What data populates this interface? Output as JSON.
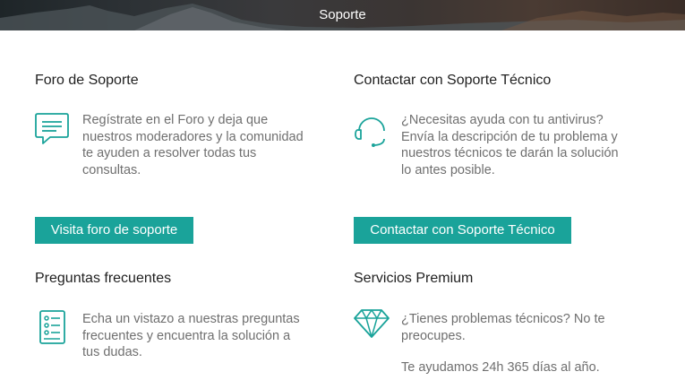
{
  "header": {
    "title": "Soporte"
  },
  "forum": {
    "title": "Foro de Soporte",
    "icon": "chat-bubble-icon",
    "desc": [
      "Regístrate en el Foro y deja que",
      "nuestros moderadores y la comunidad",
      "te ayuden a resolver todas tus",
      "consultas."
    ],
    "button": "Visita foro de soporte"
  },
  "contact": {
    "title": "Contactar con Soporte Técnico",
    "icon": "headset-icon",
    "desc": [
      "¿Necesitas ayuda con tu antivirus?",
      "Envía la descripción de tu problema y",
      "nuestros técnicos te darán la solución",
      "lo antes posible."
    ],
    "button": "Contactar con Soporte Técnico"
  },
  "faq": {
    "title": "Preguntas frecuentes",
    "icon": "checklist-icon",
    "desc": [
      "Echa un vistazo a nuestras preguntas",
      "frecuentes y encuentra la solución a",
      "tus dudas."
    ]
  },
  "premium": {
    "title": "Servicios Premium",
    "icon": "diamond-icon",
    "desc": [
      "¿Tienes problemas técnicos? No te",
      "preocupes."
    ],
    "desc2": "Te ayudamos 24h 365 días al año."
  },
  "colors": {
    "accent": "#1aa39a",
    "text": "#6f6f6f",
    "title": "#1f1f1f"
  }
}
